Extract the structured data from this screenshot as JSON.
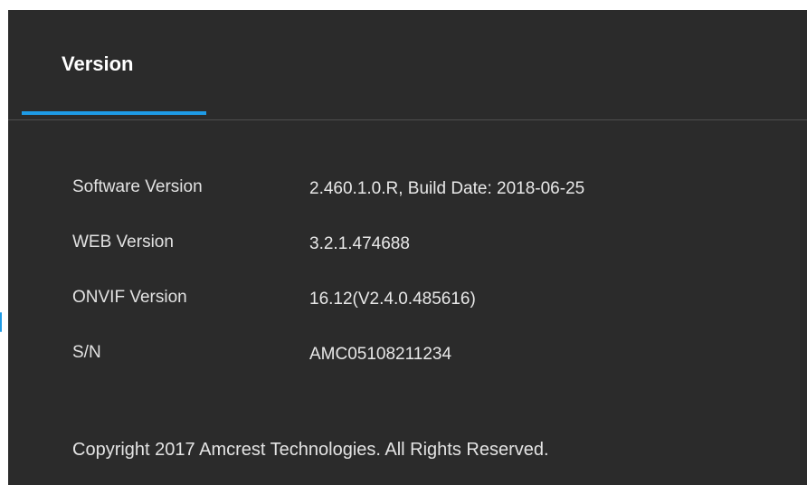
{
  "tabs": [
    {
      "label": "Version",
      "active": true
    }
  ],
  "version_info": {
    "rows": [
      {
        "label": "Software Version",
        "value": "2.460.1.0.R, Build Date: 2018-06-25"
      },
      {
        "label": "WEB Version",
        "value": "3.2.1.474688"
      },
      {
        "label": "ONVIF Version",
        "value": "16.12(V2.4.0.485616)"
      },
      {
        "label": "S/N",
        "value": "AMC05108211234"
      }
    ]
  },
  "footer": {
    "copyright": "Copyright 2017 Amcrest Technologies. All Rights Reserved."
  },
  "colors": {
    "panel_background": "#2b2b2b",
    "accent": "#1e9be6",
    "text": "#e2e2e2"
  }
}
